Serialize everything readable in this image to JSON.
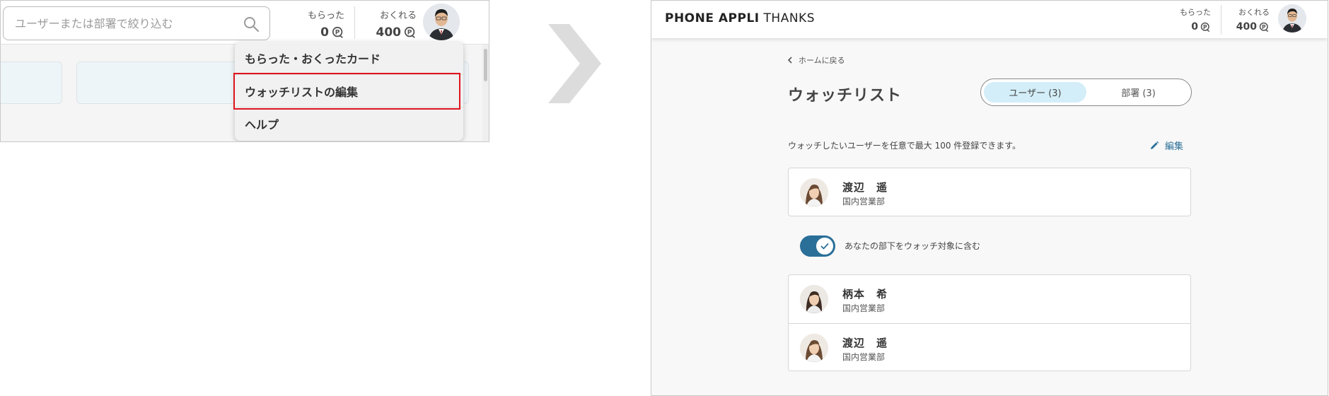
{
  "left_panel": {
    "search": {
      "placeholder": "ユーザーまたは部署で絞り込む",
      "value": ""
    },
    "received": {
      "label": "もらった",
      "value": "0"
    },
    "sent": {
      "label": "おくれる",
      "value": "400"
    },
    "menu": {
      "items": [
        {
          "label": "もらった・おくったカード"
        },
        {
          "label": "ウォッチリストの編集",
          "highlighted": true
        },
        {
          "label": "ヘルプ"
        }
      ]
    }
  },
  "right_panel": {
    "brand": {
      "strong": "PHONE APPLI",
      "light": "THANKS"
    },
    "received": {
      "label": "もらった",
      "value": "0"
    },
    "sent": {
      "label": "おくれる",
      "value": "400"
    },
    "back_link": "ホームに戻る",
    "page_title": "ウォッチリスト",
    "tabs": [
      {
        "label": "ユーザー (3)",
        "active": true
      },
      {
        "label": "部署 (3)",
        "active": false
      }
    ],
    "description": "ウォッチしたいユーザーを任意で最大 100 件登録できます。",
    "edit_label": "編集",
    "watch_users": [
      {
        "name": "渡辺　遥",
        "department": "国内営業部"
      }
    ],
    "toggle": {
      "label": "あなたの部下をウォッチ対象に含む",
      "on": true
    },
    "subordinates": [
      {
        "name": "柄本　希",
        "department": "国内営業部"
      },
      {
        "name": "渡辺　遥",
        "department": "国内営業部"
      }
    ]
  },
  "colors": {
    "accent": "#2a6f98",
    "highlight_border": "#e0141e",
    "active_tab": "#d3eef8"
  }
}
